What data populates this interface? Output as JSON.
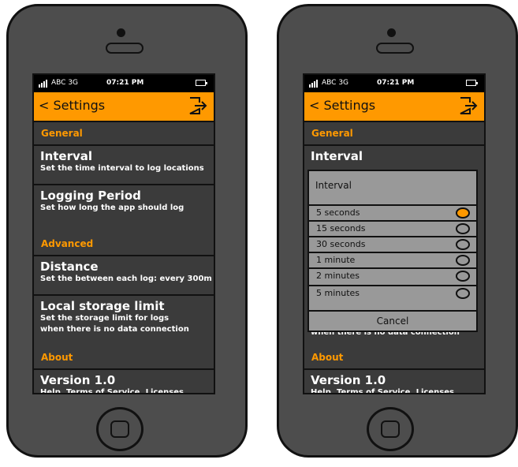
{
  "colors": {
    "accent": "#ff9900",
    "screen_bg": "#3b3b3b",
    "phone_body": "#4d4d4d",
    "dialog_bg": "#999999"
  },
  "status": {
    "carrier": "ABC 3G",
    "time": "07:21 PM"
  },
  "header": {
    "back_label": "< Settings"
  },
  "sections": {
    "general": "General",
    "advanced": "Advanced",
    "about": "About"
  },
  "items": {
    "interval": {
      "title": "Interval",
      "subtitle": "Set the time interval to log locations"
    },
    "logging": {
      "title": "Logging Period",
      "subtitle": "Set how long the app should log"
    },
    "distance": {
      "title": "Distance",
      "subtitle": "Set the  between each log: every 300m"
    },
    "storage": {
      "title": "Local storage limit",
      "subtitle_1": "Set the storage limit for logs",
      "subtitle_2": "when there is no data connection"
    },
    "version": {
      "title": "Version 1.0",
      "subtitle": "Help, Terms of Service, Licenses"
    }
  },
  "dialog": {
    "title": "Interval",
    "options": [
      "5 seconds",
      "15 seconds",
      "30 seconds",
      "1 minute",
      "2 minutes",
      "5 minutes"
    ],
    "selected": "5 seconds",
    "cancel_label": "Cancel"
  }
}
